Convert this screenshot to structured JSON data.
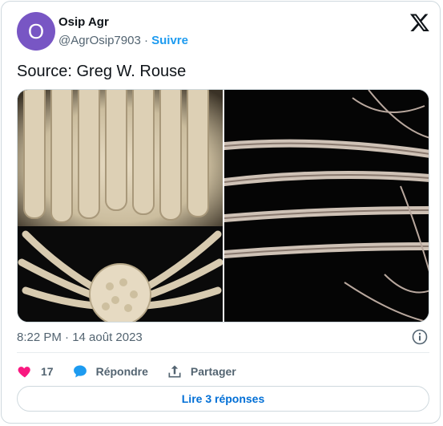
{
  "author": {
    "avatar_initial": "O",
    "avatar_color": "#7856c4",
    "display_name": "Osip Agr",
    "handle": "@AgrOsip7903",
    "separator": "·",
    "follow_label": "Suivre"
  },
  "tweet": {
    "text": "Source: Greg W. Rouse",
    "timestamp": "8:22 PM · 14 août 2023"
  },
  "media": {
    "images": [
      "crinoid-underside-photo",
      "crinoid-arms-photo"
    ]
  },
  "actions": {
    "like_count": "17",
    "reply_label": "Répondre",
    "share_label": "Partager"
  },
  "read_replies_label": "Lire 3 réponses",
  "icons": [
    "x-logo-icon",
    "info-icon",
    "heart-icon",
    "reply-bubble-icon",
    "share-icon"
  ],
  "colors": {
    "accent": "#1d9bf0",
    "like": "#f91880",
    "reply": "#1d9bf0",
    "muted": "#536471"
  }
}
